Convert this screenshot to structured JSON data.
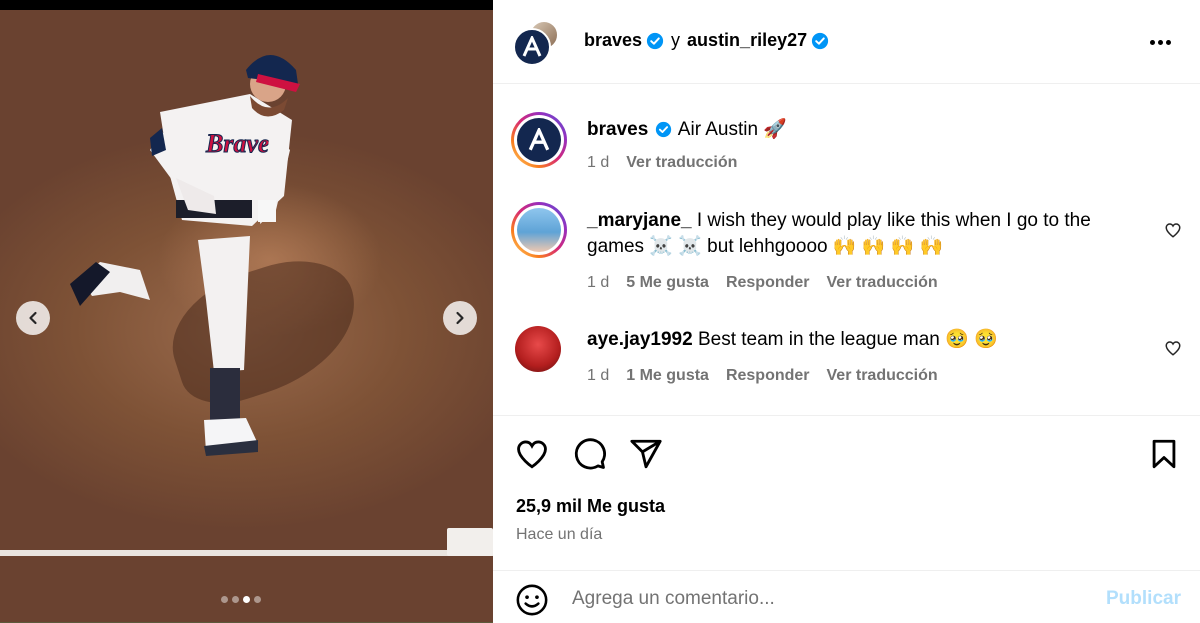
{
  "post": {
    "author": "braves",
    "coauthor_joiner": "y",
    "coauthor": "austin_riley27",
    "carousel": {
      "total": 4,
      "active": 3
    }
  },
  "caption": {
    "username": "braves",
    "text": "Air Austin",
    "emoji": "🚀",
    "time": "1 d",
    "translate": "Ver traducción"
  },
  "comments": [
    {
      "username": "_maryjane_",
      "text_line1": "I wish they would play like this when I go to the",
      "text_line2": "games ☠️ ☠️  but lehhgoooo 🙌 🙌 🙌 🙌",
      "time": "1 d",
      "likes": "5 Me gusta",
      "reply": "Responder",
      "translate": "Ver traducción"
    },
    {
      "username": "aye.jay1992",
      "text_line1": "Best team in the league man 🥹 🥹",
      "time": "1 d",
      "likes": "1 Me gusta",
      "reply": "Responder",
      "translate": "Ver traducción"
    }
  ],
  "stats": {
    "likes": "25,9 mil Me gusta",
    "posted": "Hace un día"
  },
  "composer": {
    "placeholder": "Agrega un comentario...",
    "publish": "Publicar"
  },
  "colors": {
    "verified": "#0095f6",
    "braves_navy": "#13274f",
    "braves_red": "#ce1141",
    "muted": "#737373",
    "publish_disabled": "#b2dffc"
  },
  "icons": [
    "chevron-left-icon",
    "chevron-right-icon",
    "verified-icon",
    "more-icon",
    "heart-icon",
    "comment-icon",
    "share-icon",
    "bookmark-icon",
    "emoji-icon"
  ]
}
